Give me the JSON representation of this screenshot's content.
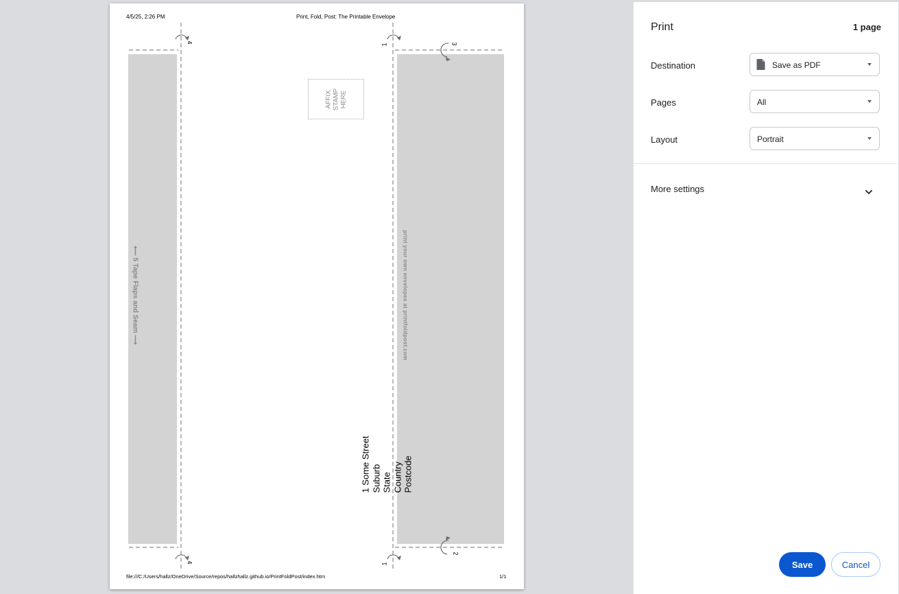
{
  "preview": {
    "header_left": "4/5/25, 2:26 PM",
    "header_center": "Print, Fold, Post: The Printable Envelope",
    "footer_left": "file:///C:/Users/hallz/OneDrive/Source/repos/hallzhallz.github.io/PrintFoldPost/index.htm",
    "footer_right": "1/1",
    "stamp_text": "AFFIX\nSTAMP\nHERE",
    "left_flap_text": "⟵ 5 Tape Flaps and Seam ⟶",
    "right_flap_text": "print your own envelopes at  printfoldpost.com",
    "address_lines": [
      "1 Some Street",
      "Suburb",
      "State",
      "Country",
      "Postcode"
    ],
    "fold_numbers": {
      "top_left": "4",
      "top_right_a": "1",
      "top_right_b": "3",
      "bottom_left": "4",
      "bottom_right_a": "1",
      "bottom_right_b": "2"
    },
    "flap_color": "#d3d3d3"
  },
  "sidebar": {
    "title": "Print",
    "page_count": "1 page",
    "destination_label": "Destination",
    "destination_value": "Save as PDF",
    "pages_label": "Pages",
    "pages_value": "All",
    "layout_label": "Layout",
    "layout_value": "Portrait",
    "more_settings": "More settings",
    "save_label": "Save",
    "cancel_label": "Cancel",
    "accent_color": "#0b57d0"
  }
}
